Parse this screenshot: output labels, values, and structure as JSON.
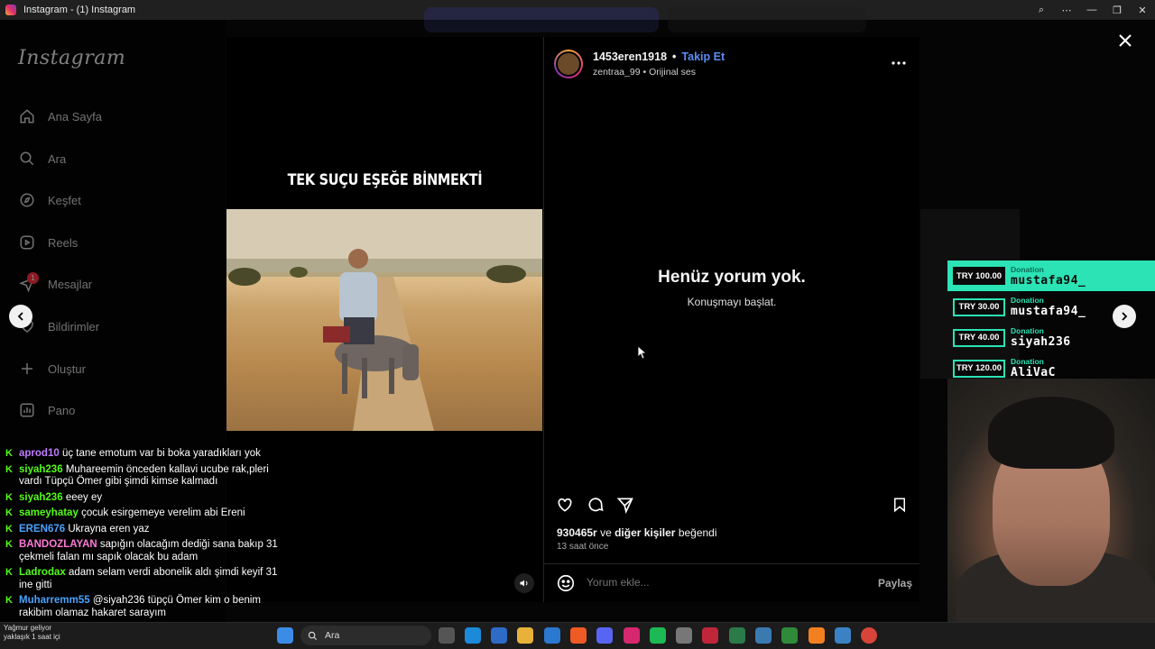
{
  "window": {
    "title": "Instagram - (1) Instagram"
  },
  "sidebar": {
    "logo": "Instagram",
    "items": [
      {
        "label": "Ana Sayfa",
        "icon": "home-icon"
      },
      {
        "label": "Ara",
        "icon": "search-icon"
      },
      {
        "label": "Keşfet",
        "icon": "compass-icon"
      },
      {
        "label": "Reels",
        "icon": "reels-icon"
      },
      {
        "label": "Mesajlar",
        "icon": "messenger-icon",
        "badge": "1"
      },
      {
        "label": "Bildirimler",
        "icon": "heart-icon"
      },
      {
        "label": "Oluştur",
        "icon": "plus-icon"
      },
      {
        "label": "Pano",
        "icon": "dashboard-icon"
      }
    ]
  },
  "post": {
    "media_title": "TEK SUÇU EŞEĞE BİNMEKTİ",
    "username": "1453eren1918",
    "follow_label": "Takip Et",
    "audio_user": "zentraa_99",
    "audio_label": "Orijinal ses",
    "empty_title": "Henüz yorum yok.",
    "empty_subtitle": "Konuşmayı başlat.",
    "likes_count": "930465r",
    "likes_suffix": "ve",
    "likes_others": "diğer kişiler",
    "likes_end": "beğendi",
    "time_ago": "13 saat önce",
    "comment_placeholder": "Yorum ekle...",
    "share_label": "Paylaş"
  },
  "donations": [
    {
      "amount": "TRY 100.00",
      "label": "Donation",
      "name": "mustafa94_"
    },
    {
      "amount": "TRY 30.00",
      "label": "Donation",
      "name": "mustafa94_"
    },
    {
      "amount": "TRY 40.00",
      "label": "Donation",
      "name": "siyah236"
    },
    {
      "amount": "TRY 120.00",
      "label": "Donation",
      "name": "AliVaC"
    }
  ],
  "chat": [
    {
      "user": "aprod10",
      "color": "#c07bff",
      "text": "üç tane emotum var bi boka yaradıkları yok"
    },
    {
      "user": "siyah236",
      "color": "#53fc18",
      "text": "Muhareemin önceden kallavi ucube rak,pleri vardı Tüpçü Ömer gibi şimdi kimse kalmadı"
    },
    {
      "user": "siyah236",
      "color": "#53fc18",
      "text": "eeey ey"
    },
    {
      "user": "sameyhatay",
      "color": "#53fc18",
      "text": "çocuk esirgemeye verelim abi Ereni"
    },
    {
      "user": "EREN676",
      "color": "#4aa3ff",
      "text": "Ukrayna eren yaz"
    },
    {
      "user": "BANDOZLAYAN",
      "color": "#ff7ad9",
      "text": "sapığın olacağım dediği sana bakıp 31 çekmeli falan mı sapık olacak bu adam"
    },
    {
      "user": "Ladrodax",
      "color": "#53fc18",
      "text": "adam selam verdi abonelik aldı şimdi keyif 31 ine gitti"
    },
    {
      "user": "Muharremm55",
      "color": "#4aa3ff",
      "text": "@siyah236 tüpçü Ömer kim o benim rakibim olamaz hakaret sarayım"
    }
  ],
  "taskbar": {
    "search_label": "Ara",
    "weather_line1": "Yağmur geliyor",
    "weather_line2": "yaklaşık 1 saat içi"
  },
  "colors": {
    "accent": "#5b8ef5",
    "kick_green": "#53fc18",
    "donation_teal": "#2be3b5"
  }
}
